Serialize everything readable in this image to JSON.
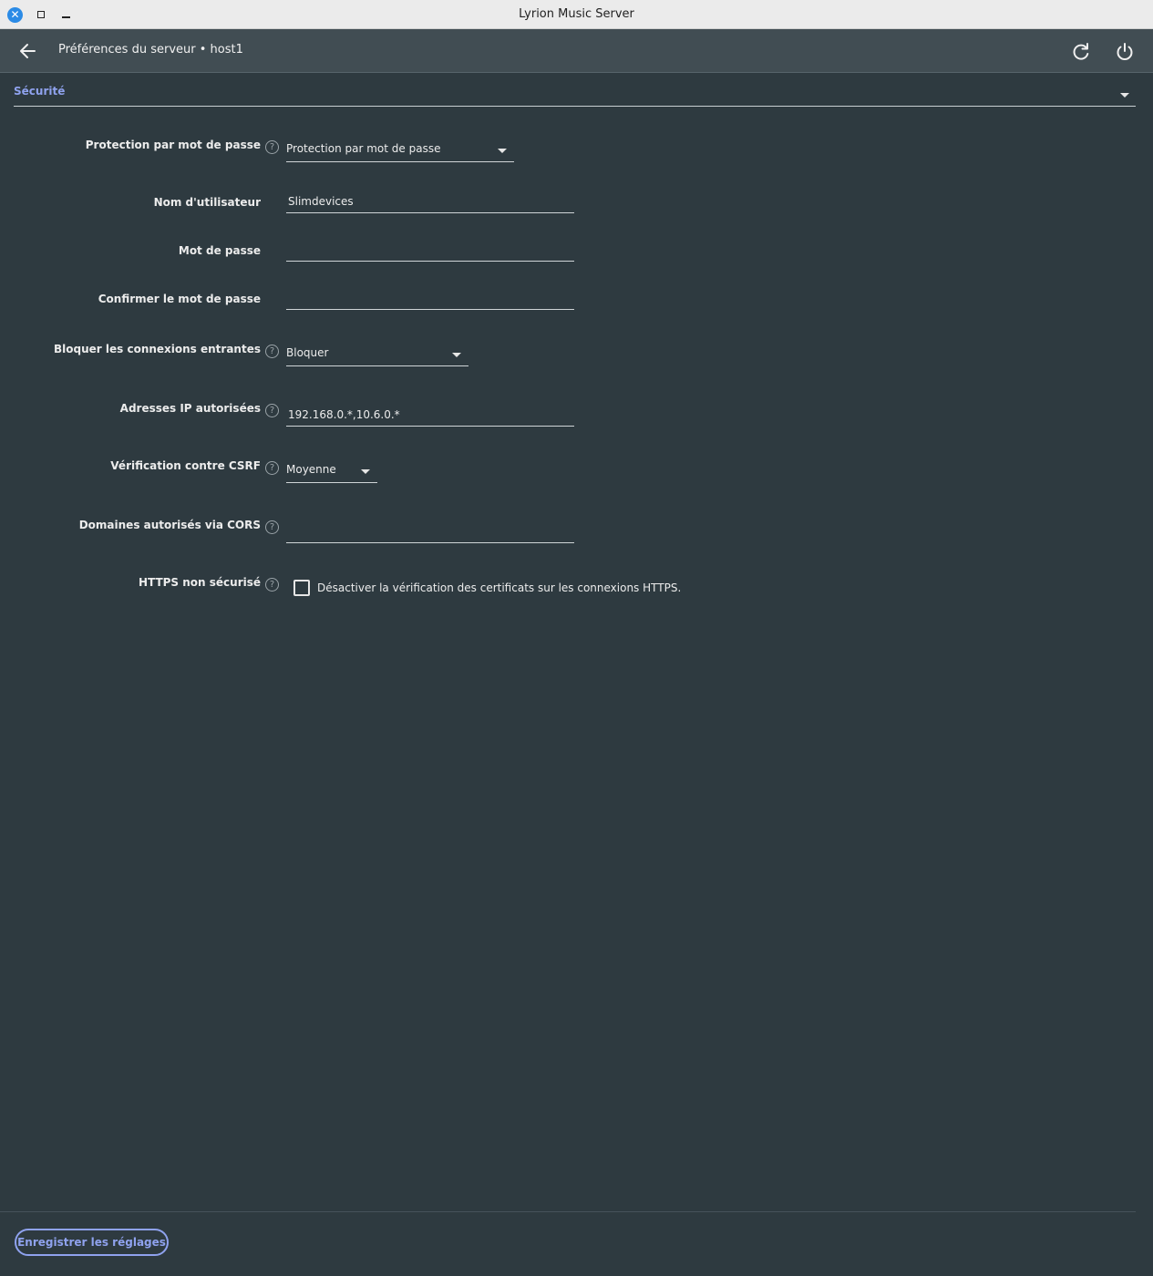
{
  "window": {
    "title": "Lyrion Music Server",
    "close_glyph": "✕"
  },
  "toolbar": {
    "title": "Préférences du serveur • host1"
  },
  "section": {
    "label": "Sécurité"
  },
  "help_glyph": "?",
  "form": {
    "password_protection": {
      "label": "Protection par mot de passe",
      "value": "Protection par mot de passe"
    },
    "username": {
      "label": "Nom d'utilisateur",
      "value": "Slimdevices"
    },
    "password": {
      "label": "Mot de passe",
      "value": ""
    },
    "confirm_password": {
      "label": "Confirmer le mot de passe",
      "value": ""
    },
    "block_incoming": {
      "label": "Bloquer les connexions entrantes",
      "value": "Bloquer"
    },
    "allowed_ips": {
      "label": "Adresses IP autorisées",
      "value": "192.168.0.*,10.6.0.*"
    },
    "csrf": {
      "label": "Vérification contre CSRF",
      "value": "Moyenne"
    },
    "cors": {
      "label": "Domaines autorisés via CORS",
      "value": ""
    },
    "insecure_https": {
      "label": "HTTPS non sécurisé",
      "checkbox_label": "Désactiver la vérification des certificats sur les connexions HTTPS.",
      "checked": false
    }
  },
  "footer": {
    "save_label": "Enregistrer les réglages"
  },
  "colors": {
    "accent": "#8fa2ee",
    "background": "#2e3a40",
    "toolbar": "#414d53"
  }
}
